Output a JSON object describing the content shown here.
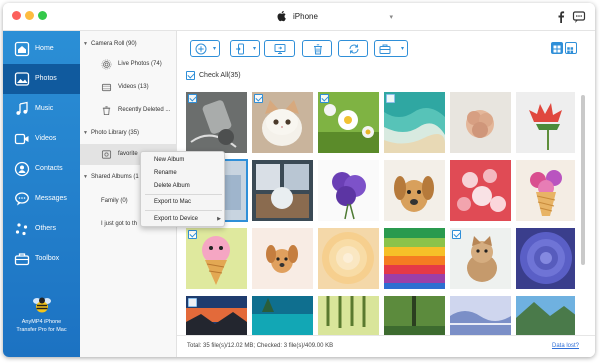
{
  "window": {
    "traffic_colors": [
      "#fc605c",
      "#fdbc40",
      "#34c84a"
    ],
    "device": "iPhone"
  },
  "sidebar": {
    "items": [
      {
        "label": "Home",
        "icon": "home-icon"
      },
      {
        "label": "Photos",
        "icon": "photos-icon",
        "active": true
      },
      {
        "label": "Music",
        "icon": "music-icon"
      },
      {
        "label": "Videos",
        "icon": "videos-icon"
      },
      {
        "label": "Contacts",
        "icon": "contacts-icon"
      },
      {
        "label": "Messages",
        "icon": "messages-icon"
      },
      {
        "label": "Others",
        "icon": "others-icon"
      },
      {
        "label": "Toolbox",
        "icon": "toolbox-icon"
      }
    ],
    "brand_line1": "AnyMP4 iPhone",
    "brand_line2": "Transfer Pro for Mac"
  },
  "tree": {
    "camera_roll": "Camera Roll (90)",
    "live_photos": "Live Photos (74)",
    "videos": "Videos (13)",
    "recently_deleted": "Recently Deleted ...",
    "photo_library": "Photo Library (35)",
    "favorites": "favorite",
    "shared_albums": "Shared Albums (1",
    "family": "Family (0)",
    "i_just_got": "I just got to th"
  },
  "context_menu": {
    "new_album": "New Album",
    "rename": "Rename",
    "delete_album": "Delete Album",
    "export_to_mac": "Export to Mac",
    "export_to_device": "Export to Device"
  },
  "main": {
    "check_all": "Check All(35)",
    "accent": "#2f8fd8",
    "checked_photos": [
      0,
      1,
      2,
      6,
      12,
      16
    ],
    "selected_photo": 6
  },
  "status": {
    "text": "Total: 35 file(s)/12.02 MB; Checked: 3 file(s)/409.00 KB",
    "data_lost": "Data lost?"
  }
}
